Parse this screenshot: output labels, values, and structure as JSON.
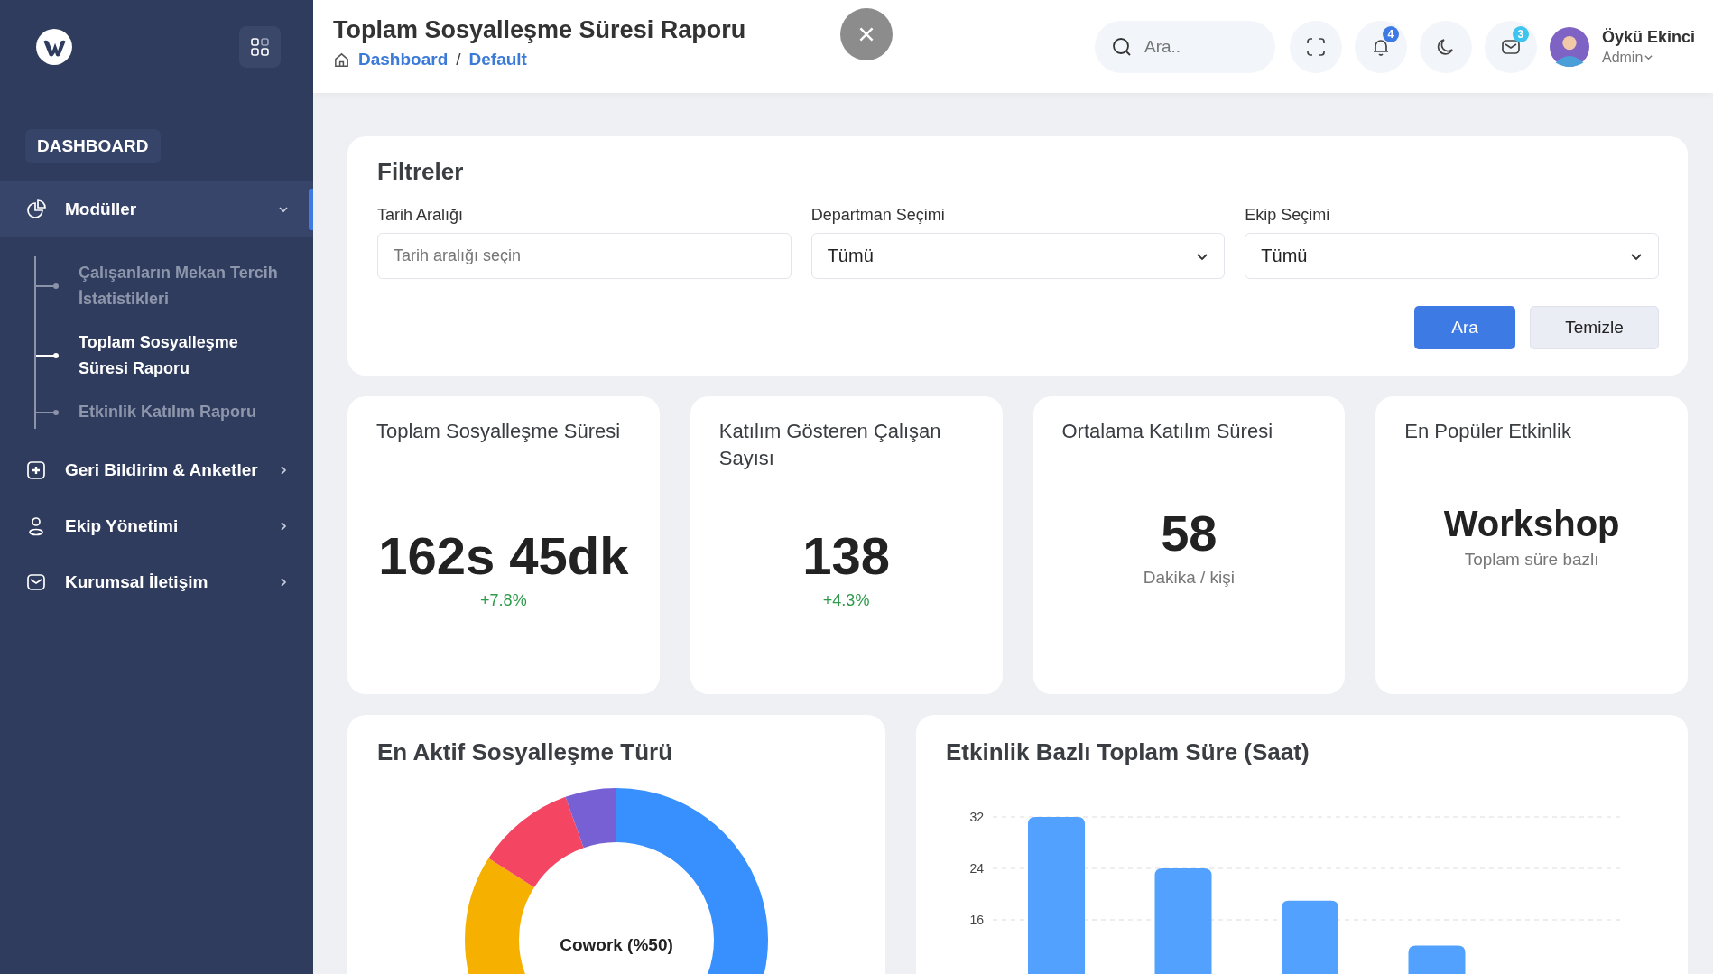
{
  "sidebar": {
    "section_label": "DASHBOARD",
    "items": [
      {
        "label": "Modüller",
        "expanded": true,
        "selected": true,
        "children": [
          {
            "label": "Çalışanların Mekan Tercih İstatistikleri",
            "selected": false
          },
          {
            "label": "Toplam Sosyalleşme Süresi Raporu",
            "selected": true
          },
          {
            "label": "Etkinlik Katılım Raporu",
            "selected": false
          }
        ]
      },
      {
        "label": "Geri Bildirim & Anketler",
        "expanded": false,
        "selected": false
      },
      {
        "label": "Ekip Yönetimi",
        "expanded": false,
        "selected": false
      },
      {
        "label": "Kurumsal İletişim",
        "expanded": false,
        "selected": false
      }
    ]
  },
  "header": {
    "title": "Toplam Sosyalleşme Süresi Raporu",
    "breadcrumb": [
      "Dashboard",
      "Default"
    ],
    "breadcrumb_separator": "/",
    "search": {
      "placeholder": "Ara.."
    },
    "notification_count": "4",
    "message_count": "3",
    "user": {
      "name": "Öykü Ekinci",
      "role": "Admin"
    }
  },
  "filters": {
    "title": "Filtreler",
    "fields": [
      {
        "label": "Tarih Aralığı",
        "kind": "text",
        "placeholder": "Tarih aralığı seçin"
      },
      {
        "label": "Departman Seçimi",
        "kind": "select",
        "value": "Tümü"
      },
      {
        "label": "Ekip Seçimi",
        "kind": "select",
        "value": "Tümü"
      }
    ],
    "buttons": [
      {
        "label": "Ara",
        "kind": "primary"
      },
      {
        "label": "Temizle",
        "kind": "secondary"
      }
    ]
  },
  "stats": [
    {
      "title": "Toplam Sosyalleşme Süresi",
      "value": "162s 45dk",
      "change": "+7.8%"
    },
    {
      "title": "Katılım Gösteren Çalışan Sayısı",
      "value": "138",
      "change": "+4.3%"
    },
    {
      "title": "Ortalama Katılım Süresi",
      "value": "58",
      "caption": "Dakika / kişi"
    },
    {
      "title": "En Popüler Etkinlik",
      "value": "Workshop",
      "caption": "Toplam süre bazlı"
    }
  ],
  "donut_card": {
    "title": "En Aktif Sosyalleşme Türü",
    "center_label": "Cowork (%50)"
  },
  "bar_card": {
    "title": "Etkinlik Bazlı Toplam Süre (Saat)",
    "chart_data": {
      "type": "bar",
      "ylim": [
        0,
        32
      ],
      "yticks": [
        16,
        24,
        32
      ],
      "series": [
        {
          "color": "#52a1ff",
          "values": [
            32,
            24,
            19,
            12
          ]
        }
      ]
    }
  }
}
